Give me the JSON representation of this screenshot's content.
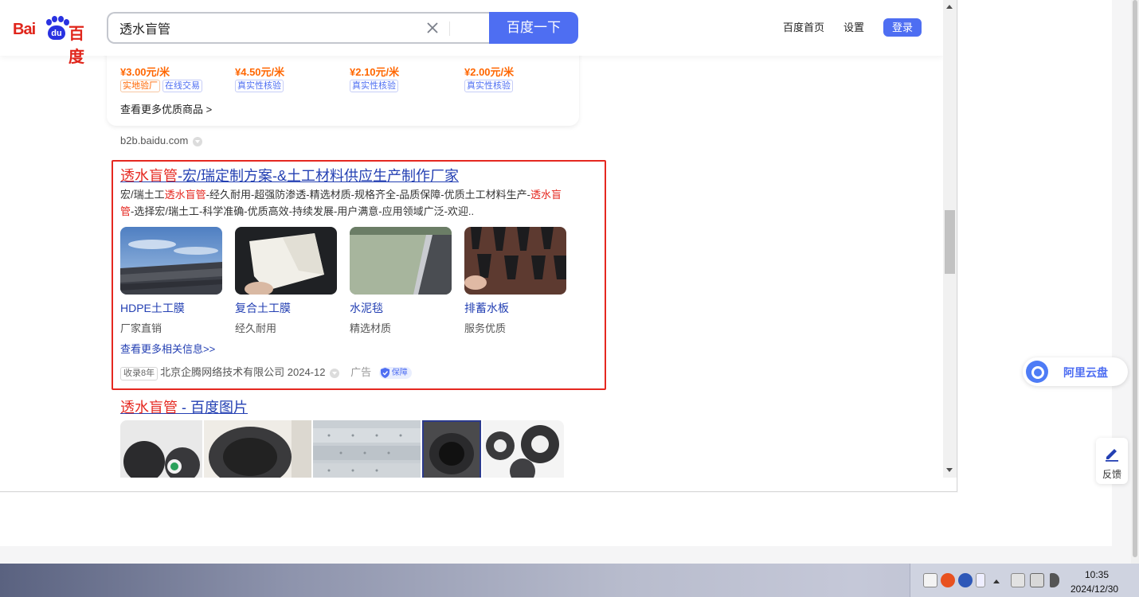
{
  "header": {
    "logo_left": "Bai",
    "logo_paw": "du",
    "logo_right": "百度",
    "search_value": "透水盲管",
    "search_button": "百度一下",
    "nav_home": "百度首页",
    "nav_settings": "设置",
    "login": "登录"
  },
  "products": [
    {
      "price": "¥3.00元/米",
      "tags": [
        "实地验厂",
        "在线交易"
      ]
    },
    {
      "price": "¥4.50元/米",
      "tags": [
        "真实性核验"
      ]
    },
    {
      "price": "¥2.10元/米",
      "tags": [
        "真实性核验"
      ]
    },
    {
      "price": "¥2.00元/米",
      "tags": [
        "真实性核验"
      ]
    }
  ],
  "more_goods": "查看更多优质商品 >",
  "b2b_source": "b2b.baidu.com",
  "ad": {
    "title_hl": "透水盲管",
    "title_rest": "-宏/瑞定制方案-&土工材料供应生产制作厂家",
    "desc_1": "宏/瑞土工",
    "desc_hl_1": "透水盲管",
    "desc_2": "-经久耐用-超强防渗透-精选材质-规格齐全-品质保障-优质土工材料生产-",
    "desc_hl_2": "透水盲管",
    "desc_3": "-选择宏/瑞土工-科学准确-优质高效-持续发展-用户满意-应用领域广泛-欢迎..",
    "items": [
      {
        "name": "HDPE土工膜",
        "sub": "厂家直销"
      },
      {
        "name": "复合土工膜",
        "sub": "经久耐用"
      },
      {
        "name": "水泥毯",
        "sub": "精选材质"
      },
      {
        "name": "排蓄水板",
        "sub": "服务优质"
      }
    ],
    "more": "查看更多相关信息>>",
    "badge": "收录8年",
    "company": "北京企腾网络技术有限公司",
    "date": "2024-12",
    "ad_label": "广告",
    "guarantee": "保障"
  },
  "image_result": {
    "title_hl": "透水盲管",
    "title_rest": " - 百度图片"
  },
  "aliyun_label": "阿里云盘",
  "feedback_label": "反馈",
  "taskbar": {
    "time": "10:35",
    "date": "2024/12/30"
  },
  "colors": {
    "brand_blue": "#4e6ef2",
    "link_blue": "#2440b3",
    "highlight_red": "#e52820",
    "price_orange": "#ff6600"
  }
}
